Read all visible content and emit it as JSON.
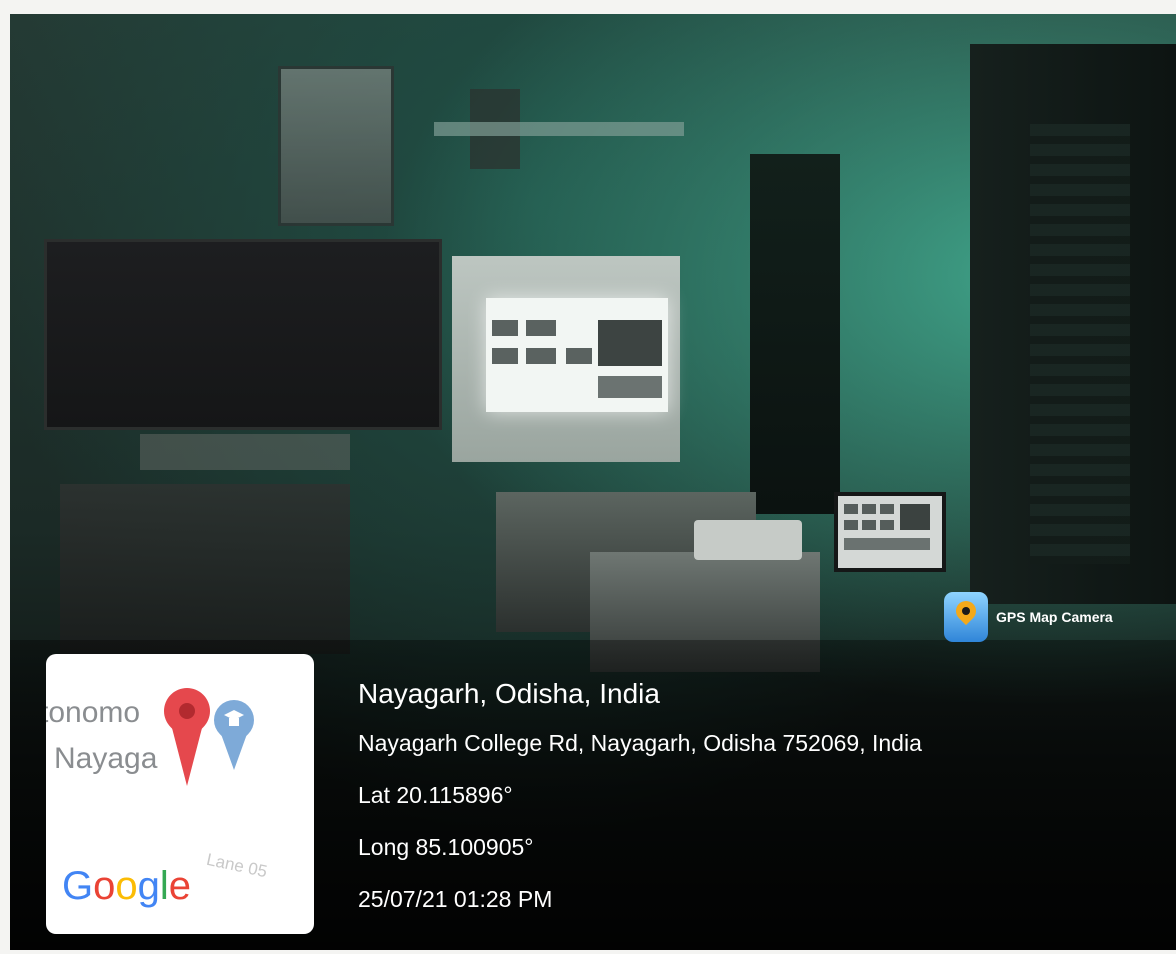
{
  "gps_badge": {
    "label": "GPS Map Camera",
    "icon": "map-pin-app-icon"
  },
  "map_thumbnail": {
    "text_line1": "tonomo",
    "text_line2": "Nayaga",
    "road_label": "Lane 05",
    "provider": [
      "G",
      "o",
      "o",
      "g",
      "l",
      "e"
    ],
    "provider_colors": [
      "#4285F4",
      "#EA4335",
      "#FBBC05",
      "#4285F4",
      "#34A853",
      "#EA4335"
    ],
    "pins": [
      "red-location-pin-icon",
      "blue-graduation-cap-pin-icon"
    ]
  },
  "location": {
    "place": "Nayagarh, Odisha, India",
    "address": "Nayagarh College Rd, Nayagarh, Odisha 752069, India",
    "latitude": "Lat 20.115896°",
    "longitude": "Long 85.100905°",
    "datetime": "25/07/21 01:28 PM"
  },
  "colors": {
    "wall_teal": "#3fa389",
    "overlay_text": "#ffffff",
    "pin_red": "#e5484d",
    "pin_blue": "#7eaad8"
  }
}
